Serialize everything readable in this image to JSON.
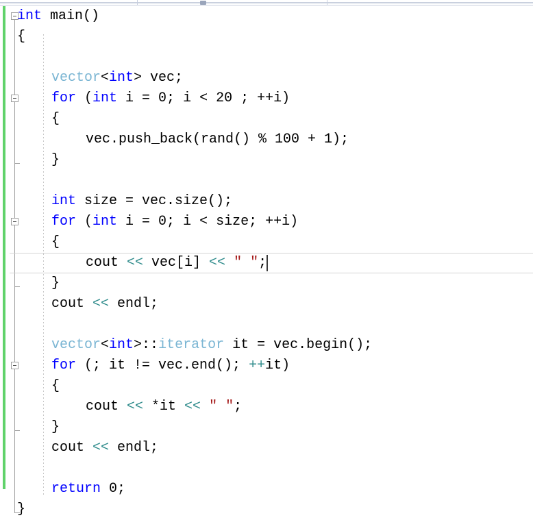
{
  "window": {
    "kind": "code-editor",
    "language": "C++",
    "background": "#ffffff"
  },
  "splitter": {
    "handle_label": "",
    "visible": true
  },
  "margins": {
    "change_bar_color": "#60d26a",
    "fold_margin_color": "#9d9d9d",
    "indent_guide_color": "#c8c8c8"
  },
  "colors": {
    "keyword": "#0000ff",
    "type": "#7ab5d3",
    "string": "#a31515",
    "operator": "#2e8b8b",
    "plain": "#000000",
    "current_line_border": "#d3d3d3",
    "caret": "#3b3b3b"
  },
  "caret": {
    "line_index": 12,
    "column_text": "    cout << endl;",
    "visible": true
  },
  "editor": {
    "current_line_index": 12,
    "line_height": 30,
    "font_size": 20,
    "lines": [
      {
        "indent": 0,
        "tokens": [
          {
            "t": "int",
            "c": "kw"
          },
          {
            "t": " main()",
            "c": "plain"
          }
        ]
      },
      {
        "indent": 0,
        "tokens": [
          {
            "t": "{",
            "c": "plain"
          }
        ]
      },
      {
        "indent": 0,
        "tokens": [
          {
            "t": "",
            "c": "plain"
          }
        ]
      },
      {
        "indent": 1,
        "tokens": [
          {
            "t": "vector",
            "c": "type"
          },
          {
            "t": "<",
            "c": "plain"
          },
          {
            "t": "int",
            "c": "kw"
          },
          {
            "t": "> vec;",
            "c": "plain"
          }
        ]
      },
      {
        "indent": 1,
        "tokens": [
          {
            "t": "for",
            "c": "kw"
          },
          {
            "t": " (",
            "c": "plain"
          },
          {
            "t": "int",
            "c": "kw"
          },
          {
            "t": " i = 0; i < 20 ; ++i)",
            "c": "plain"
          }
        ]
      },
      {
        "indent": 1,
        "tokens": [
          {
            "t": "{",
            "c": "plain"
          }
        ]
      },
      {
        "indent": 2,
        "tokens": [
          {
            "t": "vec.push_back(rand() % 100 + 1);",
            "c": "plain"
          }
        ]
      },
      {
        "indent": 1,
        "tokens": [
          {
            "t": "}",
            "c": "plain"
          }
        ]
      },
      {
        "indent": 0,
        "tokens": [
          {
            "t": "",
            "c": "plain"
          }
        ]
      },
      {
        "indent": 1,
        "tokens": [
          {
            "t": "int",
            "c": "kw"
          },
          {
            "t": " size = vec.size();",
            "c": "plain"
          }
        ]
      },
      {
        "indent": 1,
        "tokens": [
          {
            "t": "for",
            "c": "kw"
          },
          {
            "t": " (",
            "c": "plain"
          },
          {
            "t": "int",
            "c": "kw"
          },
          {
            "t": " i = 0; i < size; ++i)",
            "c": "plain"
          }
        ]
      },
      {
        "indent": 1,
        "tokens": [
          {
            "t": "{",
            "c": "plain"
          }
        ]
      },
      {
        "indent": 2,
        "tokens": [
          {
            "t": "cout ",
            "c": "plain"
          },
          {
            "t": "<<",
            "c": "op"
          },
          {
            "t": " vec[i] ",
            "c": "plain"
          },
          {
            "t": "<<",
            "c": "op"
          },
          {
            "t": " ",
            "c": "plain"
          },
          {
            "t": "\" \"",
            "c": "str"
          },
          {
            "t": ";",
            "c": "plain"
          }
        ]
      },
      {
        "indent": 1,
        "tokens": [
          {
            "t": "}",
            "c": "plain"
          }
        ]
      },
      {
        "indent": 1,
        "tokens": [
          {
            "t": "cout ",
            "c": "plain"
          },
          {
            "t": "<<",
            "c": "op"
          },
          {
            "t": " endl;",
            "c": "plain"
          }
        ]
      },
      {
        "indent": 0,
        "tokens": [
          {
            "t": "",
            "c": "plain"
          }
        ]
      },
      {
        "indent": 1,
        "tokens": [
          {
            "t": "vector",
            "c": "type"
          },
          {
            "t": "<",
            "c": "plain"
          },
          {
            "t": "int",
            "c": "kw"
          },
          {
            "t": ">::",
            "c": "plain"
          },
          {
            "t": "iterator",
            "c": "type"
          },
          {
            "t": " it = vec.begin();",
            "c": "plain"
          }
        ]
      },
      {
        "indent": 1,
        "tokens": [
          {
            "t": "for",
            "c": "kw"
          },
          {
            "t": " (; it != vec.end(); ",
            "c": "plain"
          },
          {
            "t": "++",
            "c": "op"
          },
          {
            "t": "it)",
            "c": "plain"
          }
        ]
      },
      {
        "indent": 1,
        "tokens": [
          {
            "t": "{",
            "c": "plain"
          }
        ]
      },
      {
        "indent": 2,
        "tokens": [
          {
            "t": "cout ",
            "c": "plain"
          },
          {
            "t": "<<",
            "c": "op"
          },
          {
            "t": " *it ",
            "c": "plain"
          },
          {
            "t": "<<",
            "c": "op"
          },
          {
            "t": " ",
            "c": "plain"
          },
          {
            "t": "\" \"",
            "c": "str"
          },
          {
            "t": ";",
            "c": "plain"
          }
        ]
      },
      {
        "indent": 1,
        "tokens": [
          {
            "t": "}",
            "c": "plain"
          }
        ]
      },
      {
        "indent": 1,
        "tokens": [
          {
            "t": "cout ",
            "c": "plain"
          },
          {
            "t": "<<",
            "c": "op"
          },
          {
            "t": " endl;",
            "c": "plain"
          }
        ]
      },
      {
        "indent": 0,
        "tokens": [
          {
            "t": "",
            "c": "plain"
          }
        ]
      },
      {
        "indent": 1,
        "tokens": [
          {
            "t": "return",
            "c": "kw"
          },
          {
            "t": " 0;",
            "c": "plain"
          }
        ]
      },
      {
        "indent": 0,
        "tokens": [
          {
            "t": "}",
            "c": "plain"
          }
        ]
      }
    ],
    "fold_regions": [
      {
        "box_line_index": 0,
        "start_line_index": 0,
        "end_line_index": 24,
        "collapsible": true
      },
      {
        "box_line_index": 4,
        "start_line_index": 4,
        "end_line_index": 7,
        "collapsible": true
      },
      {
        "box_line_index": 10,
        "start_line_index": 10,
        "end_line_index": 13,
        "collapsible": true
      },
      {
        "box_line_index": 17,
        "start_line_index": 17,
        "end_line_index": 20,
        "collapsible": true
      }
    ]
  }
}
